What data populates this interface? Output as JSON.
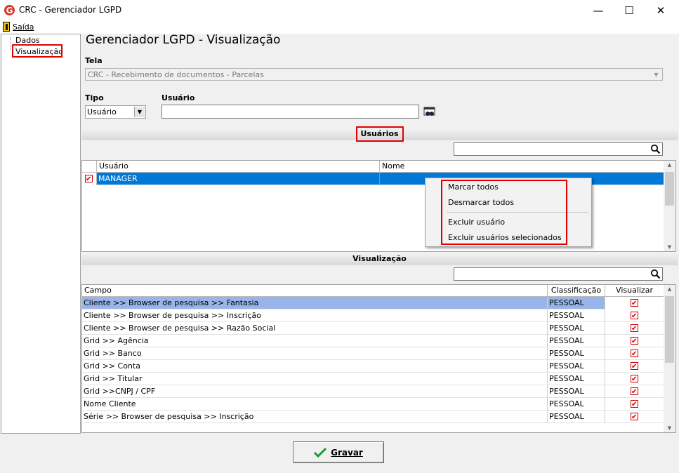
{
  "window": {
    "title": "CRC - Gerenciador LGPD",
    "minimize": "—",
    "maximize": "☐",
    "close": "✕"
  },
  "menu": {
    "exit_label": "Saída"
  },
  "tree": {
    "items": [
      "Dados",
      "Visualização"
    ]
  },
  "page_title": "Gerenciador LGPD - Visualização",
  "screen": {
    "label": "Tela",
    "value": "CRC - Recebimento de documentos - Parcelas"
  },
  "filter": {
    "type_label": "Tipo",
    "type_value": "Usuário",
    "user_label": "Usuário",
    "user_value": ""
  },
  "users_section": {
    "title": "Usuários",
    "search_value": "",
    "columns": [
      "Usuário",
      "Nome"
    ],
    "rows": [
      {
        "checked": true,
        "user": "MANAGER",
        "name": ""
      }
    ]
  },
  "context_menu": {
    "items": [
      "Marcar todos",
      "Desmarcar todos",
      "Excluir usuário",
      "Excluir usuários selecionados"
    ]
  },
  "view_section": {
    "title": "Visualização",
    "search_value": "",
    "columns": [
      "Campo",
      "Classificação",
      "Visualizar"
    ],
    "rows": [
      {
        "field": "Cliente >> Browser de pesquisa >> Fantasia",
        "class": "PESSOAL",
        "visible": true
      },
      {
        "field": "Cliente >> Browser de pesquisa >> Inscrição",
        "class": "PESSOAL",
        "visible": true
      },
      {
        "field": "Cliente >> Browser de pesquisa >> Razão Social",
        "class": "PESSOAL",
        "visible": true
      },
      {
        "field": "Grid >> Agência",
        "class": "PESSOAL",
        "visible": true
      },
      {
        "field": "Grid >> Banco",
        "class": "PESSOAL",
        "visible": true
      },
      {
        "field": "Grid >> Conta",
        "class": "PESSOAL",
        "visible": true
      },
      {
        "field": "Grid >> Titular",
        "class": "PESSOAL",
        "visible": true
      },
      {
        "field": "Grid >>CNPJ / CPF",
        "class": "PESSOAL",
        "visible": true
      },
      {
        "field": "Nome Cliente",
        "class": "PESSOAL",
        "visible": true
      },
      {
        "field": "Série >> Browser de pesquisa >> Inscrição",
        "class": "PESSOAL",
        "visible": true
      }
    ]
  },
  "save_button": "Gravar",
  "colors": {
    "selected_row": "#0078d7",
    "highlight_row": "#99b4e8",
    "annotation_red": "#e00000",
    "app_icon_red": "#d9342b"
  }
}
